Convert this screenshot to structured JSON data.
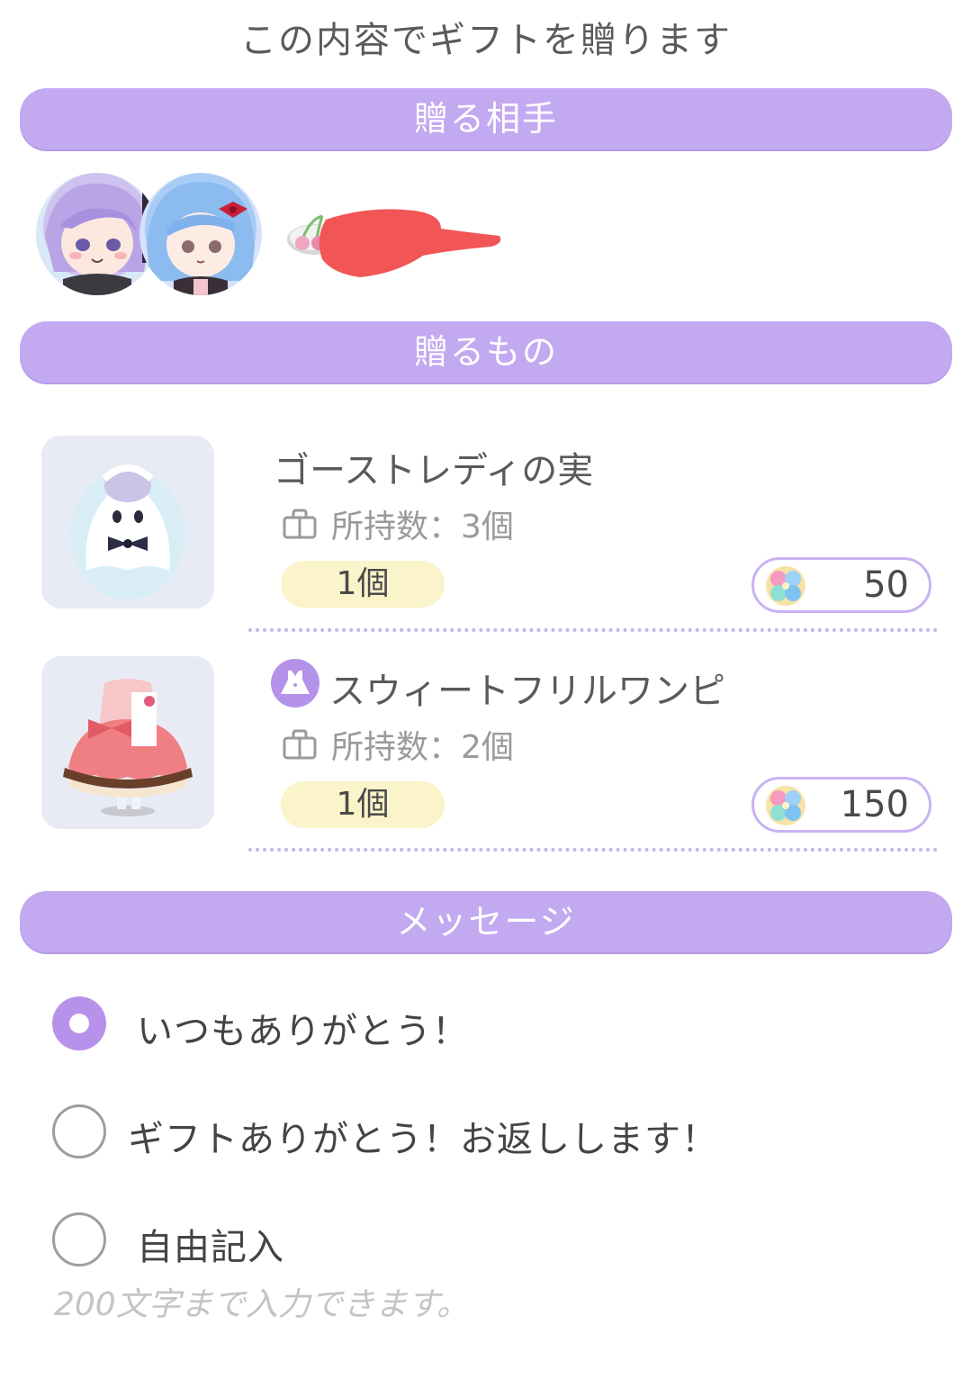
{
  "title": "この内容でギフトを贈ります",
  "recipient_section": {
    "header": "贈る相手"
  },
  "gift_section": {
    "header": "贈るもの",
    "items": [
      {
        "name": "ゴーストレディの実",
        "owned": "所持数：3個",
        "quantity": "1個",
        "price": "50"
      },
      {
        "name": "スウィートフリルワンピ",
        "owned": "所持数：2個",
        "quantity": "1個",
        "price": "150"
      }
    ]
  },
  "message_section": {
    "header": "メッセージ",
    "options": [
      {
        "label": "いつもありがとう！",
        "selected": true
      },
      {
        "label": "ギフトありがとう！お返しします！",
        "selected": false
      },
      {
        "label": "自由記入",
        "selected": false
      }
    ],
    "free_text_placeholder": "200文字まで入力できます。"
  },
  "colors": {
    "accent": "#c3a9f0",
    "qty_badge": "#fbf3c9",
    "price_border": "#c9b3f3",
    "redaction": "#f25555"
  },
  "icons": [
    "bag-icon",
    "clover-gem-icon",
    "cherry-icon",
    "dress-icon",
    "radio-selected-icon",
    "radio-empty-icon"
  ]
}
